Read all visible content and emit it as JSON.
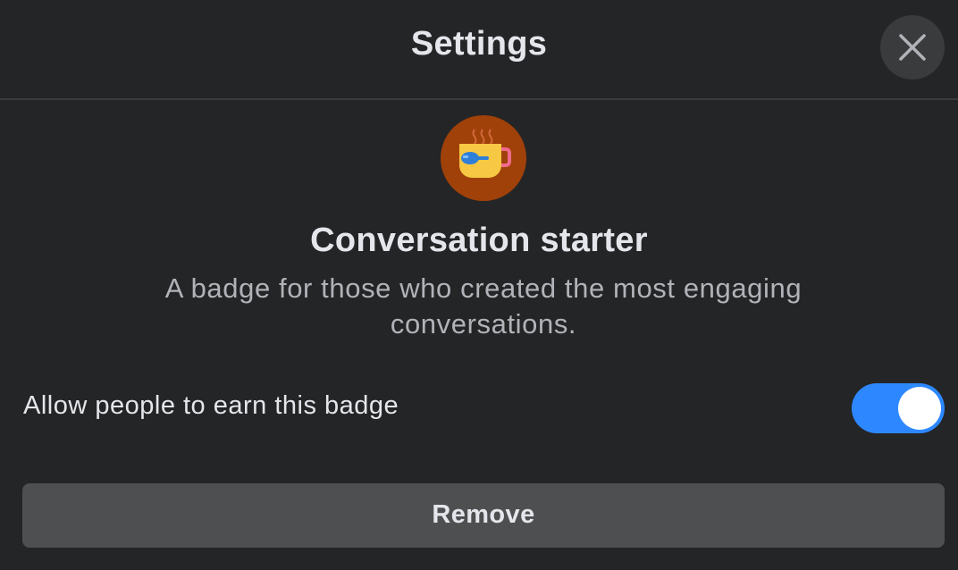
{
  "header": {
    "title": "Settings",
    "close_icon": "close-icon"
  },
  "badge": {
    "icon": "coffee-cup-icon",
    "name": "Conversation starter",
    "description": "A badge for those who created the most engaging conversations."
  },
  "setting": {
    "label": "Allow people to earn this badge",
    "enabled": true
  },
  "actions": {
    "remove_label": "Remove"
  },
  "colors": {
    "background": "#242526",
    "toggle_on": "#2d88ff",
    "button_bg": "#4e4f50",
    "badge_circle": "#a0410a",
    "cup": "#f6c843"
  }
}
